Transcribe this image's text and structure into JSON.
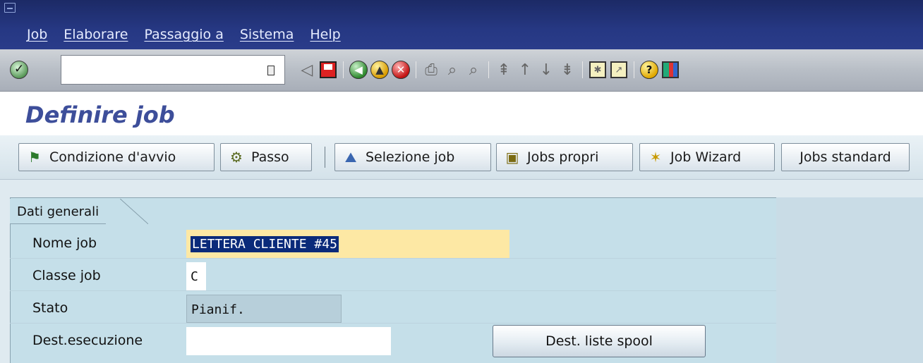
{
  "menu": {
    "items": [
      "Job",
      "Elaborare",
      "Passaggio a",
      "Sistema",
      "Help"
    ]
  },
  "toolbar": {
    "command_value": "",
    "icons": [
      "ok-check-icon",
      "back-triangle-icon",
      "save-icon",
      "back-icon",
      "exit-icon",
      "cancel-icon",
      "print-icon",
      "find-icon",
      "find-next-icon",
      "first-page-icon",
      "prev-page-icon",
      "next-page-icon",
      "last-page-icon",
      "new-session-icon",
      "shortcut-icon",
      "help-icon",
      "layout-icon"
    ]
  },
  "page": {
    "title": "Definire job"
  },
  "app_toolbar": {
    "buttons": [
      {
        "label": "Condizione d'avvio",
        "icon": "flag-icon"
      },
      {
        "label": "Passo",
        "icon": "step-icon"
      },
      {
        "label": "Selezione job",
        "icon": "job-select-icon"
      },
      {
        "label": "Jobs propri",
        "icon": "own-jobs-icon"
      },
      {
        "label": "Job Wizard",
        "icon": "wizard-icon"
      },
      {
        "label": "Jobs standard",
        "icon": ""
      }
    ]
  },
  "general_data": {
    "tab_label": "Dati generali",
    "fields": {
      "job_name": {
        "label": "Nome job",
        "value": "LETTERA CLIENTE #45"
      },
      "job_class": {
        "label": "Classe job",
        "value": "C"
      },
      "status": {
        "label": "Stato",
        "value": "Pianif."
      },
      "exec_target": {
        "label": "Dest.esecuzione",
        "value": ""
      }
    },
    "spool_button_label": "Dest. liste spool"
  },
  "colors": {
    "menubar": "#263883",
    "title": "#3d4e9a",
    "focused_field": "#fde8a4",
    "selection": "#0a2a7a"
  }
}
